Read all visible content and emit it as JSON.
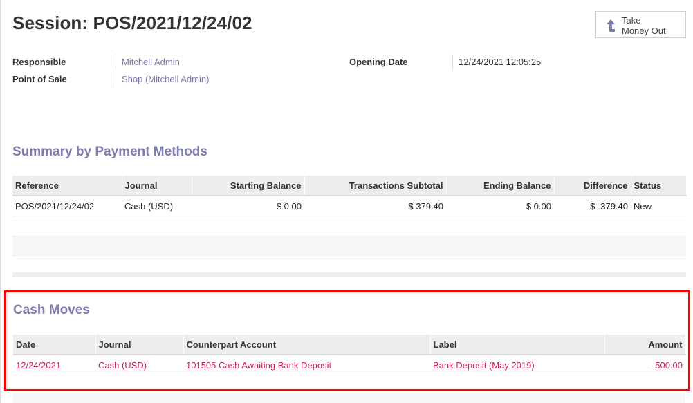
{
  "header": {
    "title": "Session: POS/2021/12/24/02",
    "take_money_out_line1": "Take",
    "take_money_out_line2": "Money Out"
  },
  "fields": {
    "responsible_label": "Responsible",
    "responsible_value": "Mitchell Admin",
    "pos_label": "Point of Sale",
    "pos_value": "Shop (Mitchell Admin)",
    "opening_date_label": "Opening Date",
    "opening_date_value": "12/24/2021 12:05:25"
  },
  "summary": {
    "title": "Summary by Payment Methods",
    "columns": [
      "Reference",
      "Journal",
      "Starting Balance",
      "Transactions Subtotal",
      "Ending Balance",
      "Difference",
      "Status"
    ],
    "rows": [
      [
        "POS/2021/12/24/02",
        "Cash (USD)",
        "$ 0.00",
        "$ 379.40",
        "$ 0.00",
        "$ -379.40",
        "New"
      ]
    ]
  },
  "cash_moves": {
    "title": "Cash Moves",
    "columns": [
      "Date",
      "Journal",
      "Counterpart Account",
      "Label",
      "Amount"
    ],
    "rows": [
      [
        "12/24/2021",
        "Cash (USD)",
        "101505 Cash Awaiting Bank Deposit",
        "Bank Deposit (May 2019)",
        "-500.00"
      ]
    ]
  },
  "colors": {
    "accent": "#7c7bad",
    "highlight_border": "#ff0000",
    "cash_text": "#c7254e"
  },
  "icons": {
    "take_money_out": "arrow-up-icon"
  }
}
